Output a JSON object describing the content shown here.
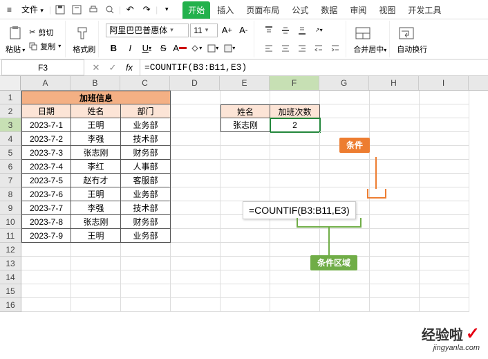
{
  "menubar": {
    "menu_btn": "≡",
    "file_btn": "文件",
    "tabs": [
      "开始",
      "插入",
      "页面布局",
      "公式",
      "数据",
      "审阅",
      "视图",
      "开发工具"
    ]
  },
  "ribbon": {
    "cut_label": "剪切",
    "copy_label": "复制",
    "paste_label": "粘贴",
    "format_painter": "格式刷",
    "font_name": "阿里巴巴普惠体",
    "font_size": "11",
    "merge_label": "合并居中",
    "wrap_label": "自动换行"
  },
  "formula_bar": {
    "cell_ref": "F3",
    "formula": "=COUNTIF(B3:B11,E3)"
  },
  "columns": [
    "A",
    "B",
    "C",
    "D",
    "E",
    "F",
    "G",
    "H",
    "I"
  ],
  "rows": [
    "1",
    "2",
    "3",
    "4",
    "5",
    "6",
    "7",
    "8",
    "9",
    "10",
    "11",
    "12",
    "13",
    "14",
    "15",
    "16"
  ],
  "main": {
    "title": "加班信息",
    "headers": {
      "date": "日期",
      "name": "姓名",
      "dept": "部门"
    },
    "data": [
      {
        "date": "2023-7-1",
        "name": "王明",
        "dept": "业务部"
      },
      {
        "date": "2023-7-2",
        "name": "李强",
        "dept": "技术部"
      },
      {
        "date": "2023-7-3",
        "name": "张志刚",
        "dept": "财务部"
      },
      {
        "date": "2023-7-4",
        "name": "李红",
        "dept": "人事部"
      },
      {
        "date": "2023-7-5",
        "name": "赵冇才",
        "dept": "客服部"
      },
      {
        "date": "2023-7-6",
        "name": "王明",
        "dept": "业务部"
      },
      {
        "date": "2023-7-7",
        "name": "李强",
        "dept": "技术部"
      },
      {
        "date": "2023-7-8",
        "name": "张志刚",
        "dept": "财务部"
      },
      {
        "date": "2023-7-9",
        "name": "王明",
        "dept": "业务部"
      }
    ]
  },
  "summary": {
    "name_hdr": "姓名",
    "count_hdr": "加班次数",
    "name_val": "张志刚",
    "count_val": "2"
  },
  "annotation": {
    "formula_text": "=COUNTIF(B3:B11,E3)",
    "range_label": "条件区域",
    "criteria_label": "条件"
  },
  "watermark": {
    "line1": "经验啦",
    "line2": "jingyanla.com"
  }
}
